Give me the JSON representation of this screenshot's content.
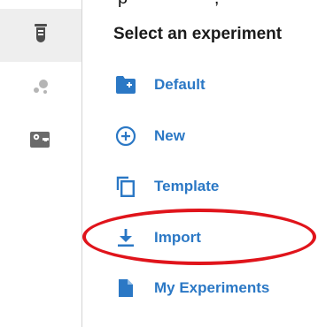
{
  "top_clipped_text": "p · · · · · · · ·, ·",
  "colors": {
    "accent": "#2b78c5",
    "rail_active_bg": "#eeeeee",
    "rail_icon": "#4d4d4d",
    "annotation_red": "#e0141b"
  },
  "rail": {
    "items": [
      {
        "icon": "flask-icon",
        "active": true
      },
      {
        "icon": "bubbles-icon",
        "active": false
      },
      {
        "icon": "gear-flask-icon",
        "active": false
      }
    ]
  },
  "panel": {
    "heading": "Select an experiment",
    "items": [
      {
        "label": "Default",
        "icon": "folder-plus-icon"
      },
      {
        "label": "New",
        "icon": "plus-circle-icon"
      },
      {
        "label": "Template",
        "icon": "copy-icon"
      },
      {
        "label": "Import",
        "icon": "download-icon"
      },
      {
        "label": "My Experiments",
        "icon": "document-icon"
      }
    ]
  }
}
